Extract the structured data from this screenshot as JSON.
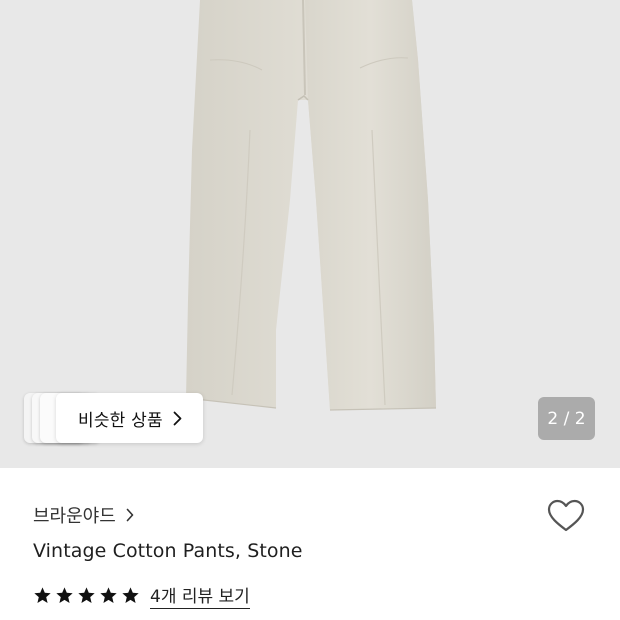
{
  "gallery": {
    "current_page": 2,
    "page_indicator": "2 / 2"
  },
  "similar": {
    "label": "비슷한 상품"
  },
  "product": {
    "brand": "브라운야드",
    "name": "Vintage Cotton Pants, Stone"
  },
  "rating": {
    "stars": 5,
    "review_link": "4개 리뷰 보기"
  },
  "icons": {
    "wishlist": "heart-outline-icon",
    "brand_chevron": "chevron-right-icon",
    "similar_chevron": "chevron-right-icon",
    "star": "star-filled-icon"
  },
  "colors": {
    "pants": "#dedbd2",
    "image_background": "#e8e8e8"
  }
}
